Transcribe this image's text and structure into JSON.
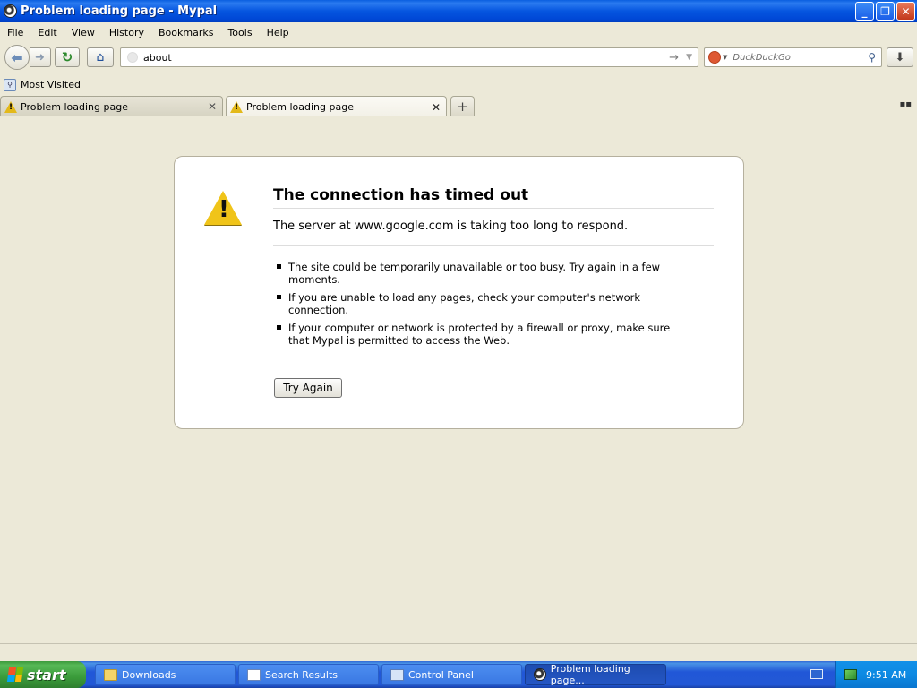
{
  "window": {
    "title": "Problem loading page - Mypal"
  },
  "menu": [
    "File",
    "Edit",
    "View",
    "History",
    "Bookmarks",
    "Tools",
    "Help"
  ],
  "navbar": {
    "url": "about",
    "search_engine": "DuckDuckGo",
    "search_placeholder": "DuckDuckGo"
  },
  "bookmarks": {
    "most_visited": "Most Visited"
  },
  "tabs": [
    {
      "label": "Problem loading page",
      "active": false
    },
    {
      "label": "Problem loading page",
      "active": true
    }
  ],
  "error": {
    "title": "The connection has timed out",
    "description": "The server at www.google.com is taking too long to respond.",
    "items": [
      "The site could be temporarily unavailable or too busy. Try again in a few moments.",
      "If you are unable to load any pages, check your computer's network connection.",
      "If your computer or network is protected by a firewall or proxy, make sure that Mypal is permitted to access the Web."
    ],
    "button": "Try Again"
  },
  "taskbar": {
    "start": "start",
    "tasks": [
      {
        "label": "Downloads",
        "icon": "folder-icon",
        "active": false
      },
      {
        "label": "Search Results",
        "icon": "search-results-icon",
        "active": false
      },
      {
        "label": "Control Panel",
        "icon": "control-panel-icon",
        "active": false
      },
      {
        "label": "Problem loading page...",
        "icon": "mypal-icon",
        "active": true
      }
    ],
    "clock": "9:51 AM"
  }
}
